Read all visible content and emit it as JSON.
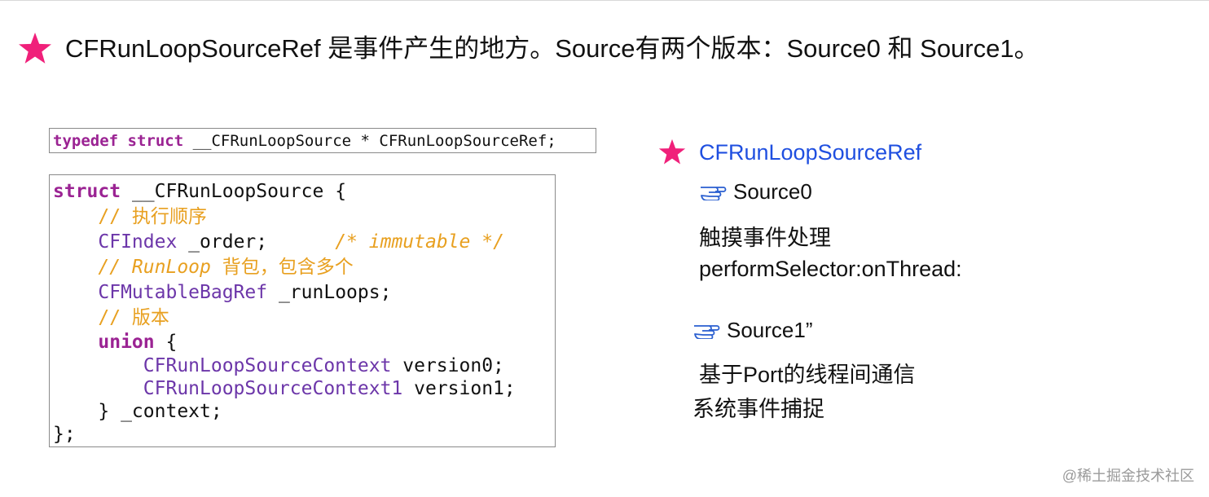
{
  "heading": {
    "icon": "star-icon",
    "text": "CFRunLoopSourceRef 是事件产生的地方。Source有两个版本：Source0 和 Source1。"
  },
  "code_typedef": {
    "kw1": "typedef",
    "kw2": "struct",
    "rest": " __CFRunLoopSource * CFRunLoopSourceRef;"
  },
  "code_struct": {
    "lines": [
      {
        "parts": [
          {
            "t": "struct",
            "c": "kw"
          },
          {
            "t": " __CFRunLoopSource {",
            "c": ""
          }
        ]
      },
      {
        "parts": [
          {
            "t": "    // 执行顺序",
            "c": "cm-cn"
          }
        ]
      },
      {
        "parts": [
          {
            "t": "    ",
            "c": ""
          },
          {
            "t": "CFIndex",
            "c": "type"
          },
          {
            "t": " _order;      ",
            "c": ""
          },
          {
            "t": "/* immutable */",
            "c": "cm"
          }
        ]
      },
      {
        "parts": [
          {
            "t": "    ",
            "c": ""
          },
          {
            "t": "// RunLoop",
            "c": "cm"
          },
          {
            "t": " 背包，包含多个",
            "c": "cm-cn"
          }
        ]
      },
      {
        "parts": [
          {
            "t": "    ",
            "c": ""
          },
          {
            "t": "CFMutableBagRef",
            "c": "type"
          },
          {
            "t": " _runLoops;",
            "c": ""
          }
        ]
      },
      {
        "parts": [
          {
            "t": "    // 版本",
            "c": "cm-cn"
          }
        ]
      },
      {
        "parts": [
          {
            "t": "    ",
            "c": ""
          },
          {
            "t": "union",
            "c": "kw"
          },
          {
            "t": " {",
            "c": ""
          }
        ]
      },
      {
        "parts": [
          {
            "t": "        ",
            "c": ""
          },
          {
            "t": "CFRunLoopSourceContext",
            "c": "type"
          },
          {
            "t": " version0;",
            "c": ""
          }
        ]
      },
      {
        "parts": [
          {
            "t": "        ",
            "c": ""
          },
          {
            "t": "CFRunLoopSourceContext1",
            "c": "type"
          },
          {
            "t": " version1;",
            "c": ""
          }
        ]
      },
      {
        "parts": [
          {
            "t": "    } _context;",
            "c": ""
          }
        ]
      },
      {
        "parts": [
          {
            "t": "};",
            "c": ""
          }
        ]
      }
    ]
  },
  "right_panel": {
    "title_icon": "star-icon",
    "title": "CFRunLoopSourceRef",
    "source0": {
      "icon": "pointing-hand-icon",
      "label": "Source0"
    },
    "source0_desc": [
      "触摸事件处理",
      "performSelector:onThread:"
    ],
    "source1": {
      "icon": "pointing-hand-icon",
      "label": "Source1”"
    },
    "source1_desc": [
      "基于Port的线程间通信",
      "系统事件捕捉"
    ]
  },
  "watermark": "@稀土掘金技术社区",
  "colors": {
    "star": "#f0207a",
    "title_blue": "#1f4fe0",
    "keyword": "#9b2393",
    "type": "#6c36a9",
    "comment": "#e8a020"
  }
}
